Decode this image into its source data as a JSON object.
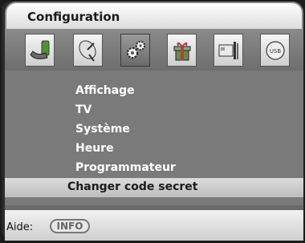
{
  "window": {
    "title": "Configuration"
  },
  "icons": [
    {
      "name": "install-icon"
    },
    {
      "name": "satellite-dish-icon"
    },
    {
      "name": "gears-icon"
    },
    {
      "name": "gift-box-icon"
    },
    {
      "name": "card-tools-icon"
    },
    {
      "name": "usb-icon",
      "label": "USB"
    }
  ],
  "menu": {
    "items": [
      {
        "label": "Affichage"
      },
      {
        "label": "TV"
      },
      {
        "label": "Système"
      },
      {
        "label": "Heure"
      },
      {
        "label": "Programmateur"
      },
      {
        "label": "Changer code secret",
        "selected": true
      }
    ]
  },
  "footer": {
    "help_label": "Aide:",
    "info_button": "INFO"
  }
}
